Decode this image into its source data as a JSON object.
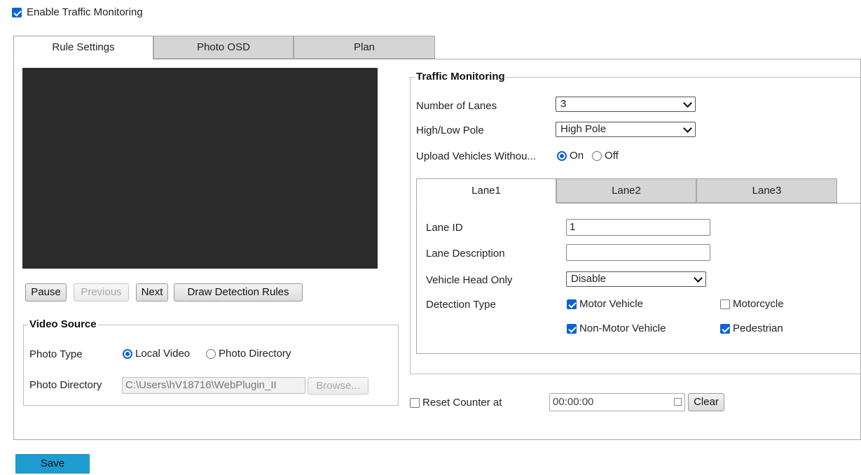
{
  "enable_traffic_monitoring": {
    "label": "Enable Traffic Monitoring",
    "checked": true
  },
  "main_tabs": [
    {
      "label": "Rule Settings",
      "active": true
    },
    {
      "label": "Photo OSD",
      "active": false
    },
    {
      "label": "Plan",
      "active": false
    }
  ],
  "video_controls": {
    "pause": "Pause",
    "previous": "Previous",
    "next": "Next",
    "draw_rules": "Draw Detection Rules"
  },
  "video_source": {
    "legend": "Video Source",
    "photo_type_label": "Photo Type",
    "local_video": "Local Video",
    "photo_directory_option": "Photo Directory",
    "photo_directory_label": "Photo Directory",
    "photo_directory_value": "C:\\Users\\hV18716\\WebPlugin_II",
    "browse": "Browse..."
  },
  "traffic_monitoring": {
    "legend": "Traffic Monitoring",
    "lanes_label": "Number of Lanes",
    "lanes_value": "3",
    "pole_label": "High/Low Pole",
    "pole_value": "High Pole",
    "upload_label": "Upload Vehicles Withou...",
    "on": "On",
    "off": "Off"
  },
  "lane_tabs": [
    {
      "label": "Lane1",
      "active": true
    },
    {
      "label": "Lane2",
      "active": false
    },
    {
      "label": "Lane3",
      "active": false
    }
  ],
  "lane": {
    "id_label": "Lane ID",
    "id_value": "1",
    "desc_label": "Lane Description",
    "desc_value": "",
    "head_label": "Vehicle Head Only",
    "head_value": "Disable",
    "detection_label": "Detection Type",
    "motor_vehicle": "Motor Vehicle",
    "motorcycle": "Motorcycle",
    "non_motor_vehicle": "Non-Motor Vehicle",
    "pedestrian": "Pedestrian"
  },
  "reset_counter": {
    "label": "Reset Counter at",
    "time": "00:00:00",
    "clear": "Clear"
  },
  "save": "Save",
  "colors": {
    "accent": "#0b63d6",
    "save_button": "#1e9bcf",
    "video_bg": "#2b2b2b"
  }
}
